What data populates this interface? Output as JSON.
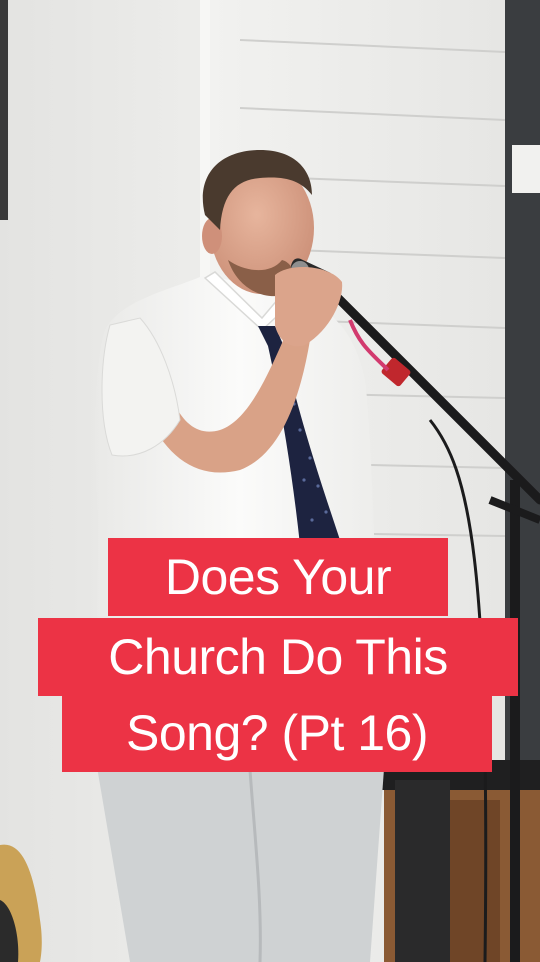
{
  "photo": {
    "subject": "person-singing",
    "colors": {
      "wall": "#ecebe8",
      "shiplap": "#f4f4f2",
      "shirt": "#f6f6f4",
      "tie": "#1d2340",
      "pants": "#cfd2d3",
      "dark_panel": "#3a3d40",
      "wood": "#8a5a34"
    }
  },
  "caption": {
    "line1": "Does Your",
    "line2": "Church Do This",
    "line3": "Song? (Pt 16)",
    "background": "#ec3345",
    "text_color": "#ffffff"
  }
}
